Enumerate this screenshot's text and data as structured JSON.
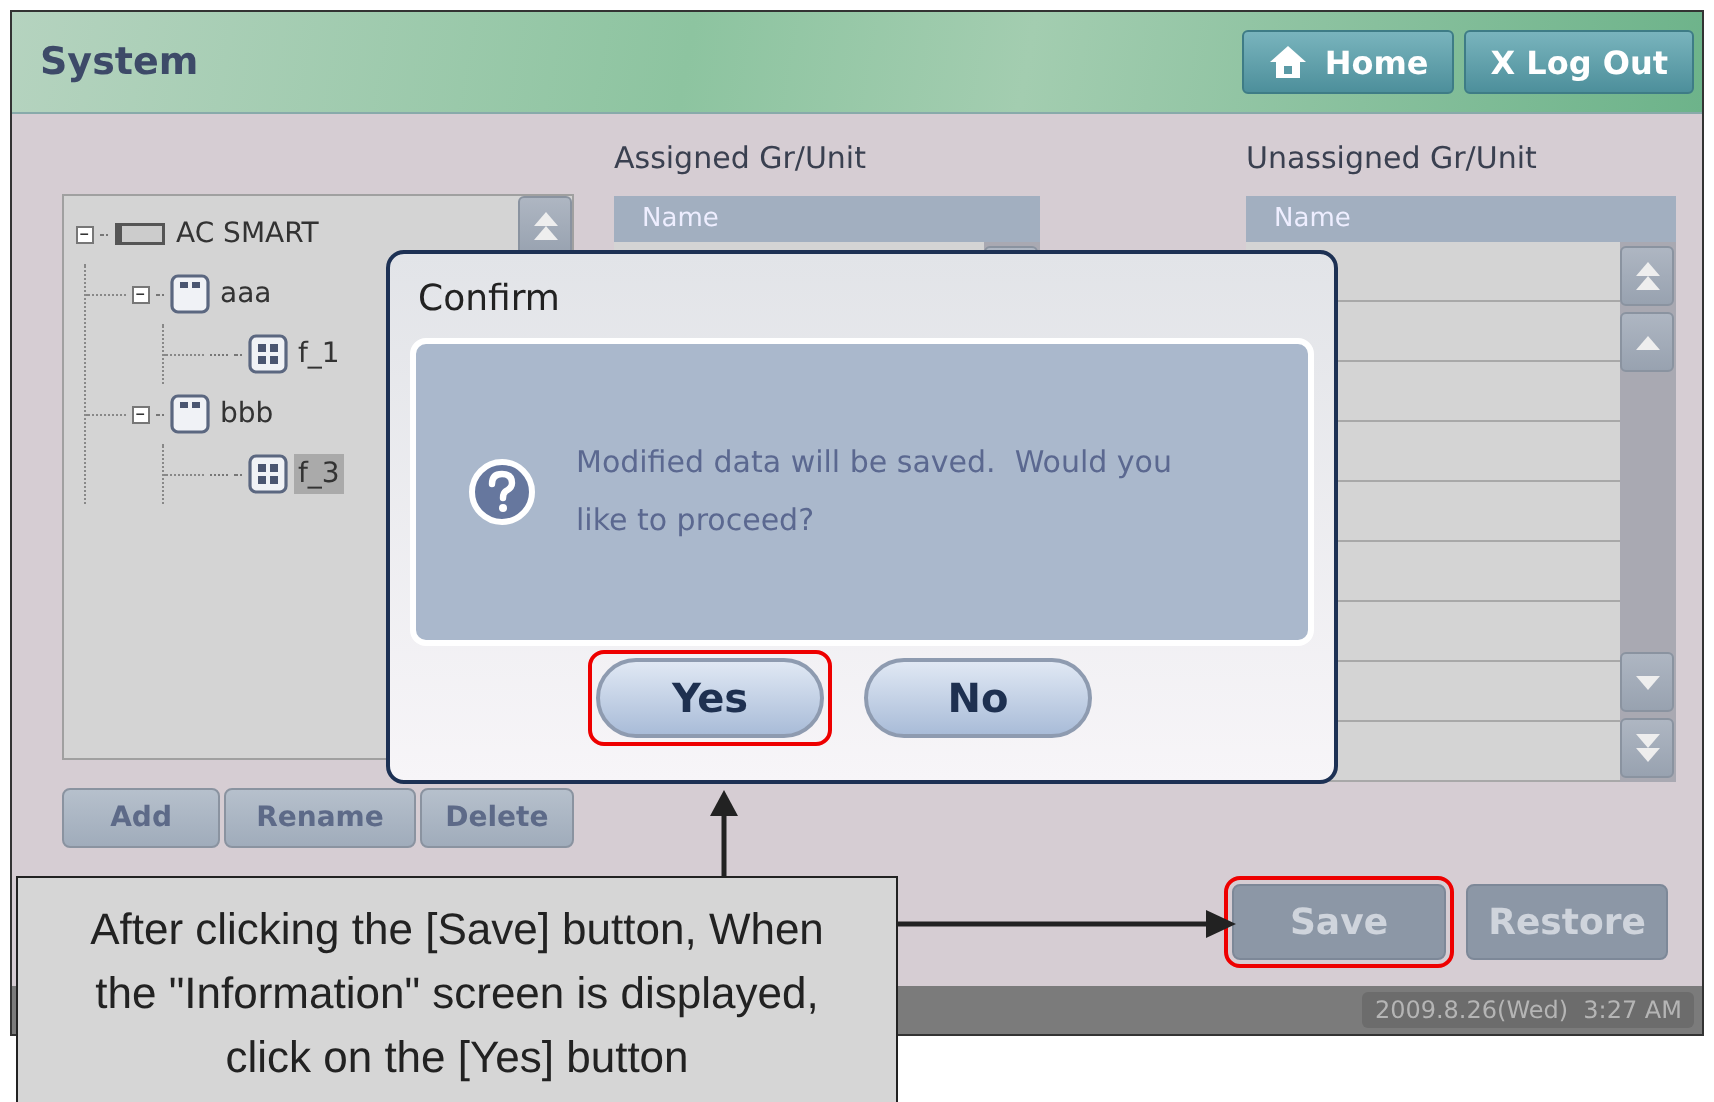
{
  "header": {
    "title": "System",
    "buttons": [
      {
        "kind": "home",
        "label": "Home"
      },
      {
        "kind": "plain",
        "label": "X Log Out"
      }
    ]
  },
  "tree": {
    "items": [
      {
        "label": "AC SMART",
        "kind": "controller",
        "expanded": true,
        "selected": false,
        "children": [
          {
            "label": "aaa",
            "kind": "group",
            "expanded": true,
            "selected": false,
            "children": [
              {
                "label": "f_1",
                "kind": "unit",
                "selected": false
              }
            ]
          },
          {
            "label": "bbb",
            "kind": "group",
            "expanded": true,
            "selected": false,
            "children": [
              {
                "label": "f_3",
                "kind": "unit",
                "selected": true
              }
            ]
          }
        ]
      }
    ]
  },
  "tree_buttons": [
    "Add",
    "Rename",
    "Delete"
  ],
  "assigned": {
    "title": "Assigned Gr/Unit",
    "column": "Name"
  },
  "unassigned": {
    "title": "Unassigned Gr/Unit",
    "column": "Name"
  },
  "actions": [
    {
      "label": "Save",
      "highlighted": true
    },
    {
      "label": "Restore",
      "highlighted": false
    }
  ],
  "status_bar": {
    "datetime": "2009.8.26(Wed)  3:27 AM"
  },
  "dialog": {
    "title": "Confirm",
    "message": "Modified data will be saved.  Would you like to proceed?",
    "buttons": [
      {
        "label": "Yes",
        "highlighted": true
      },
      {
        "label": "No",
        "highlighted": false
      }
    ]
  },
  "callout": {
    "text": "After clicking the [Save] button, When the \"Information\" screen is displayed, click on the [Yes] button"
  }
}
